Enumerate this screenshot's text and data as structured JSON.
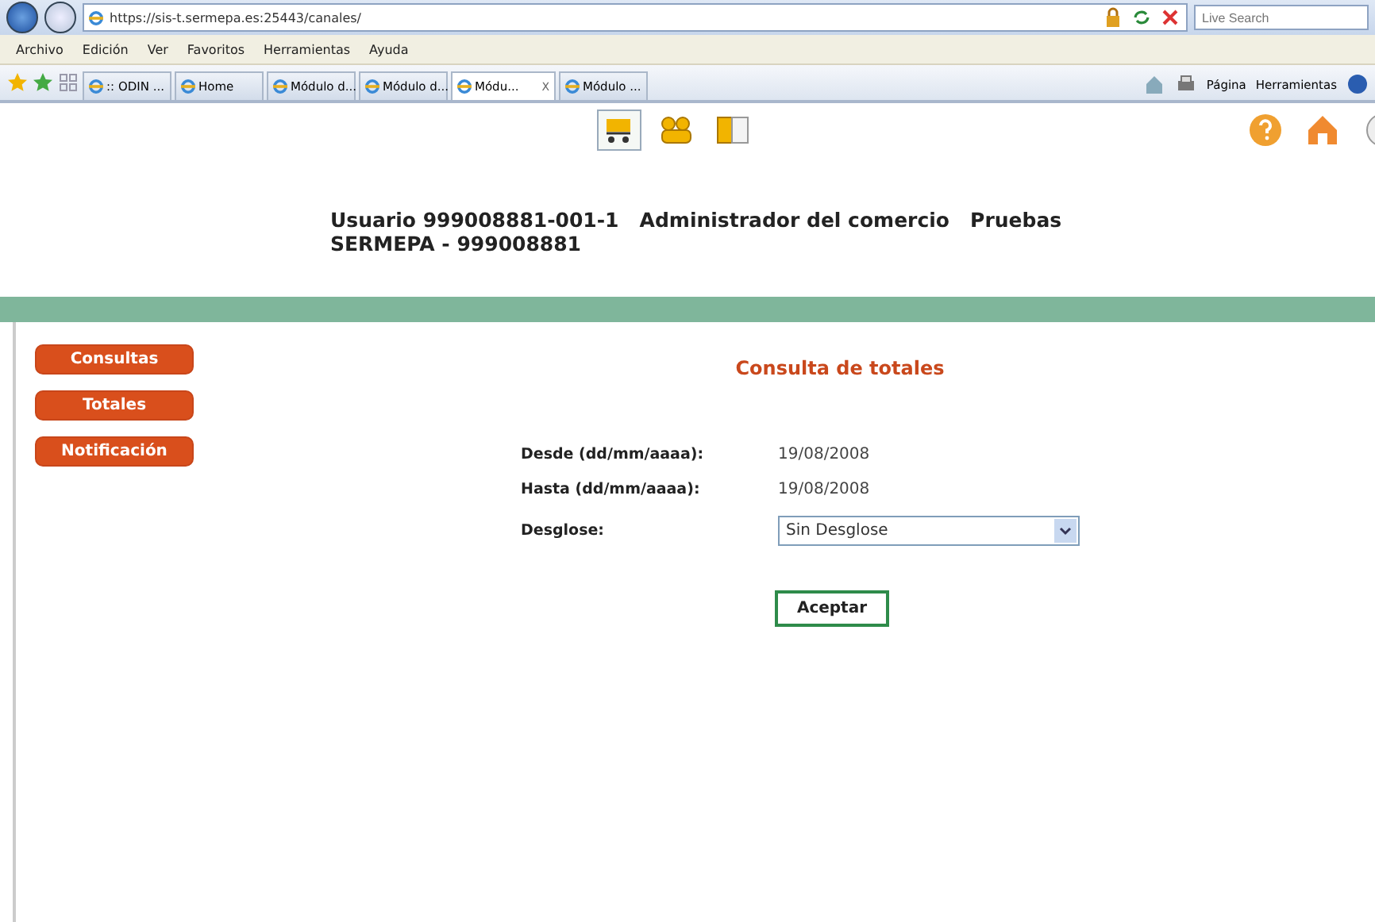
{
  "browser": {
    "address": "https://sis-t.sermepa.es:25443/canales/",
    "search_placeholder": "Live Search",
    "menu": [
      "Archivo",
      "Edición",
      "Ver",
      "Favoritos",
      "Herramientas",
      "Ayuda"
    ],
    "tabs": [
      {
        "label": ":: ODIN ...",
        "selected": false
      },
      {
        "label": "Home",
        "selected": false
      },
      {
        "label": "Módulo d...",
        "selected": false
      },
      {
        "label": "Módulo d...",
        "selected": false
      },
      {
        "label": "Módu...",
        "selected": true
      },
      {
        "label": "Módulo ...",
        "selected": false
      }
    ],
    "tab_close": "X",
    "tools": [
      "Página",
      "Herramientas"
    ]
  },
  "header": {
    "apps": [
      {
        "kind": "cart",
        "selected": true
      },
      {
        "kind": "people",
        "selected": false
      },
      {
        "kind": "book",
        "selected": false
      }
    ],
    "user_line": "Usuario 999008881-001-1   Administrador del comercio   Pruebas SERMEPA - 999008881"
  },
  "sidebar": {
    "items": [
      "Consultas",
      "Totales",
      "Notificación"
    ]
  },
  "form": {
    "title": "Consulta de totales",
    "fields": [
      {
        "kind": "text",
        "label": "Desde (dd/mm/aaaa):",
        "value": "19/08/2008"
      },
      {
        "kind": "text",
        "label": "Hasta (dd/mm/aaaa):",
        "value": "19/08/2008"
      },
      {
        "kind": "select",
        "label": "Desglose:",
        "value": "Sin Desglose"
      }
    ],
    "submit": "Aceptar"
  }
}
